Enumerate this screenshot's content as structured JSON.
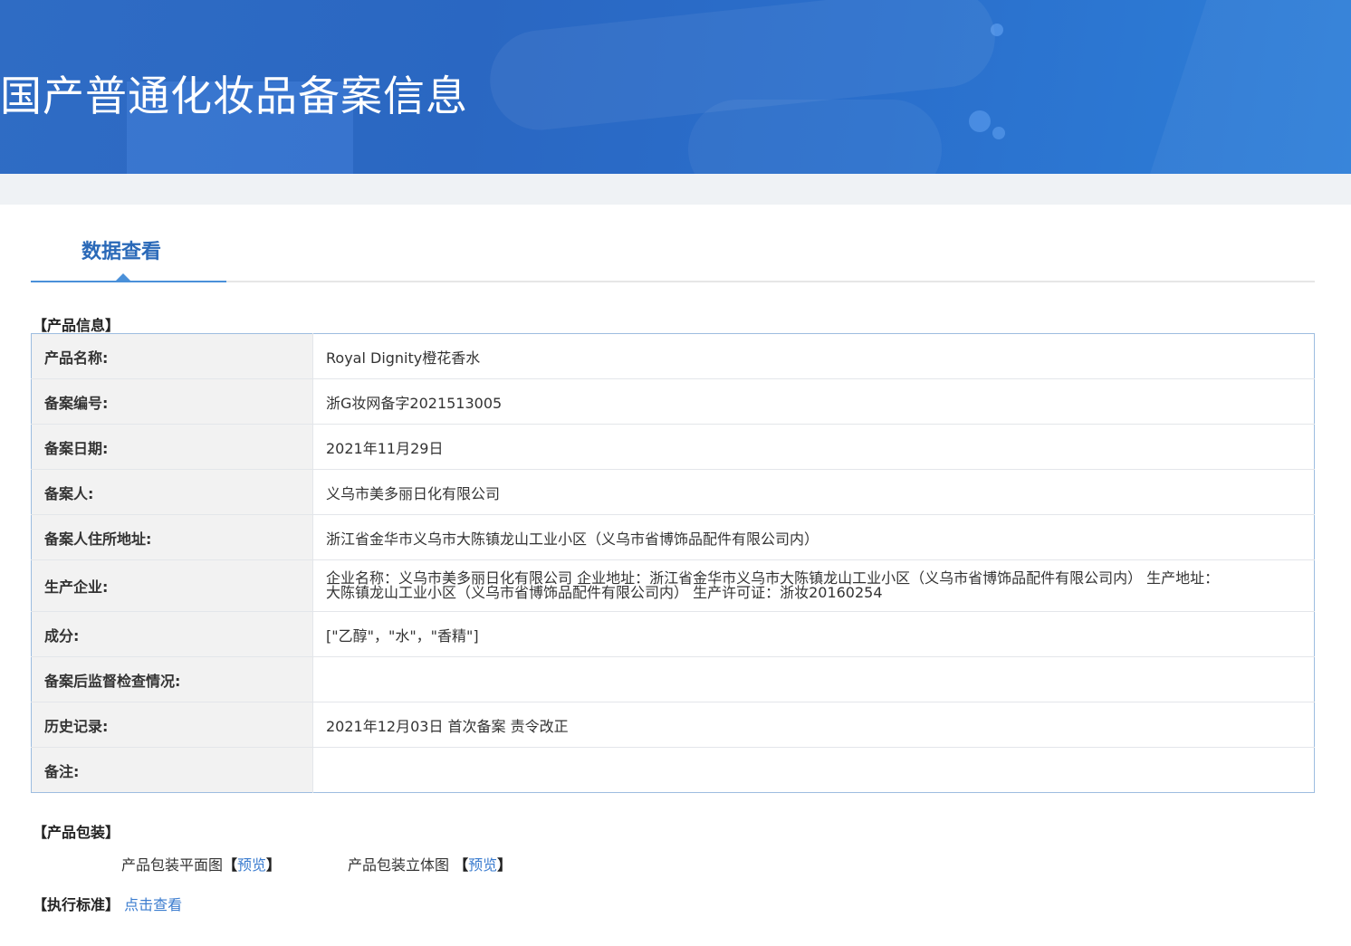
{
  "banner": {
    "title": "国产普通化妆品备案信息"
  },
  "tabs": {
    "active_label": "数据查看"
  },
  "product_info": {
    "heading": "【产品信息】",
    "rows": [
      {
        "label": "产品名称:",
        "value": "Royal Dignity橙花香水"
      },
      {
        "label": "备案编号:",
        "value": "浙G妆网备字2021513005"
      },
      {
        "label": "备案日期:",
        "value": "2021年11月29日"
      },
      {
        "label": "备案人:",
        "value": "义乌市美多丽日化有限公司"
      },
      {
        "label": "备案人住所地址:",
        "value": "浙江省金华市义乌市大陈镇龙山工业小区（义乌市省博饰品配件有限公司内）"
      },
      {
        "label": "生产企业:",
        "value": "企业名称：义乌市美多丽日化有限公司 企业地址：浙江省金华市义乌市大陈镇龙山工业小区（义乌市省博饰品配件有限公司内） 生产地址：大陈镇龙山工业小区（义乌市省博饰品配件有限公司内） 生产许可证：浙妆20160254"
      },
      {
        "label": "成分:",
        "value": "[\"乙醇\"，\"水\"，\"香精\"]"
      },
      {
        "label": "备案后监督检查情况:",
        "value": ""
      },
      {
        "label": "历史记录:",
        "value": "2021年12月03日 首次备案 责令改正"
      },
      {
        "label": "备注:",
        "value": ""
      }
    ]
  },
  "packaging": {
    "heading": "【产品包装】",
    "flat_label": "产品包装平面图",
    "flat_bracket_open": "【",
    "flat_link": "预览",
    "flat_bracket_close": "】",
    "solid_label": "产品包装立体图",
    "solid_bracket_open": "【",
    "solid_link": "预览",
    "solid_bracket_close": "】"
  },
  "standard": {
    "heading": "【执行标准】",
    "link": "点击查看"
  },
  "colors": {
    "banner_blue": "#2a67c2",
    "tab_active": "#2a69b8",
    "link": "#3b7ccf",
    "table_border": "#9dbde0",
    "label_bg": "#f2f2f2"
  }
}
